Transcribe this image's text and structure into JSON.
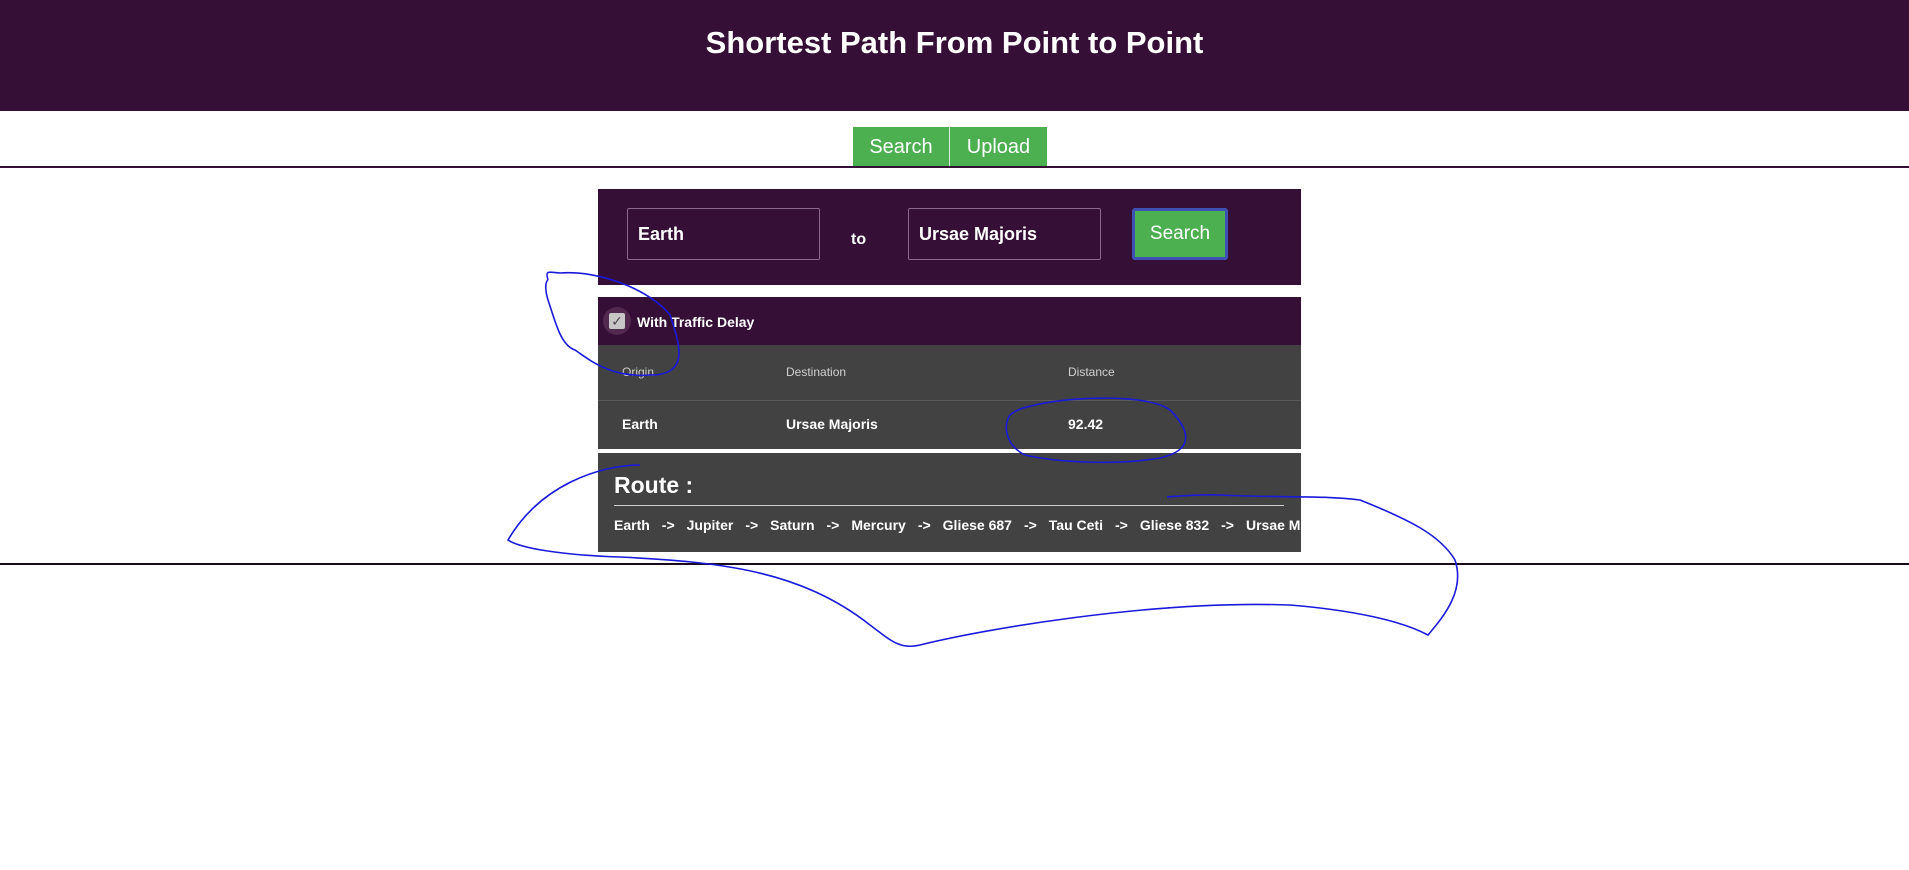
{
  "header": {
    "title": "Shortest Path From Point to Point"
  },
  "nav": {
    "search_label": "Search",
    "upload_label": "Upload"
  },
  "search": {
    "origin_value": "Earth",
    "to_label": "to",
    "destination_value": "Ursae Majoris",
    "button_label": "Search"
  },
  "traffic": {
    "label": "With Traffic Delay",
    "checked": true
  },
  "results": {
    "columns": [
      "Origin",
      "Destination",
      "Distance"
    ],
    "rows": [
      {
        "origin": "Earth",
        "destination": "Ursae Majoris",
        "distance": "92.42"
      }
    ]
  },
  "route": {
    "title": "Route :",
    "separator": "->",
    "stops": [
      "Earth",
      "Jupiter",
      "Saturn",
      "Mercury",
      "Gliese 687",
      "Tau Ceti",
      "Gliese 832",
      "Ursae Majoris"
    ]
  },
  "colors": {
    "header_bg": "#360f37",
    "accent_green": "#4caf50",
    "table_bg": "#424242",
    "annotation_ink": "#1a1adb"
  }
}
